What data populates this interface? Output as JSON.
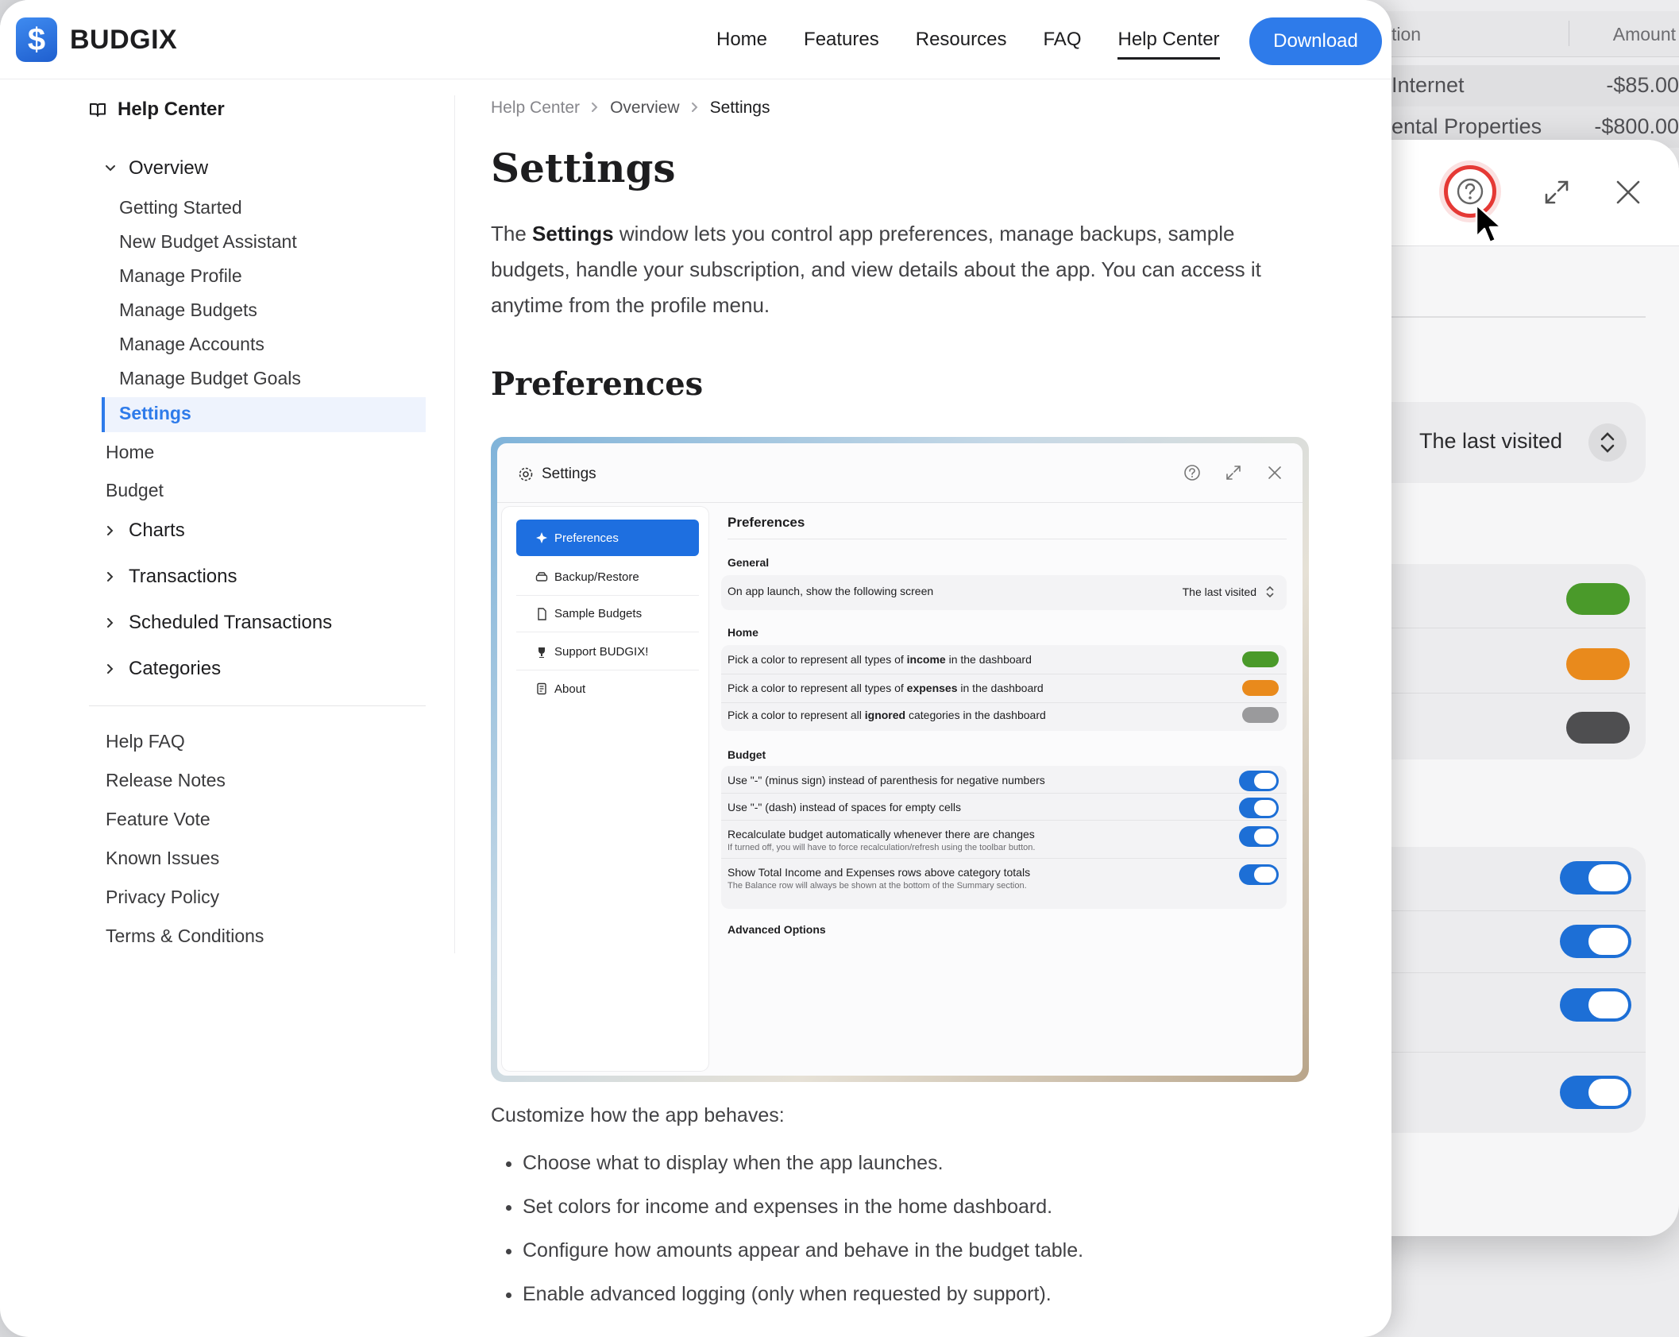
{
  "background": {
    "table": {
      "headers": [
        "tion",
        "Amount"
      ],
      "rows": [
        {
          "name": "Internet",
          "amount": "-$85.00"
        },
        {
          "name": "ental Properties",
          "amount": "-$800.00"
        }
      ]
    },
    "dialog": {
      "launch_value": "The last visited",
      "pill_colors": [
        "#4a9a2a",
        "#e98a1c",
        "#4e4e50"
      ],
      "toggles_on": [
        true,
        true,
        true,
        true
      ]
    }
  },
  "brand": {
    "name": "BUDGIX",
    "logo_glyph": "$",
    "accent": "#2e7bea"
  },
  "nav": {
    "links": [
      "Home",
      "Features",
      "Resources",
      "FAQ",
      "Help Center"
    ],
    "active": "Help Center",
    "download": "Download"
  },
  "sidebar": {
    "title": "Help Center",
    "overview": {
      "label": "Overview",
      "children": [
        "Getting Started",
        "New Budget Assistant",
        "Manage Profile",
        "Manage Budgets",
        "Manage Accounts",
        "Manage Budget Goals",
        "Settings"
      ],
      "active": "Settings"
    },
    "top_items": [
      "Home",
      "Budget"
    ],
    "groups": [
      "Charts",
      "Transactions",
      "Scheduled Transactions",
      "Categories"
    ],
    "links": [
      "Help FAQ",
      "Release Notes",
      "Feature Vote",
      "Known Issues",
      "Privacy Policy",
      "Terms & Conditions"
    ]
  },
  "content": {
    "breadcrumb": [
      "Help Center",
      "Overview",
      "Settings"
    ],
    "title": "Settings",
    "intro_pre": "The ",
    "intro_bold": "Settings",
    "intro_post": " window lets you control app preferences, manage backups, sample budgets, handle your subscription, and view details about the app. You can access it anytime from the profile menu.",
    "section_title": "Preferences",
    "paragraph": "Customize how the app behaves:",
    "bullets": [
      "Choose what to display when the app launches.",
      "Set colors for income and expenses in the home dashboard.",
      "Configure how amounts appear and behave in the budget table.",
      "Enable advanced logging (only when requested by support)."
    ]
  },
  "screenshot": {
    "window_title": "Settings",
    "nav": [
      "Preferences",
      "Backup/Restore",
      "Sample Budgets",
      "Support BUDGIX!",
      "About"
    ],
    "active_nav": "Preferences",
    "heading": "Preferences",
    "general": {
      "label": "General",
      "launch_text": "On app launch, show the following screen",
      "launch_value": "The last visited"
    },
    "home": {
      "label": "Home",
      "rows": [
        {
          "pre": "Pick a color to represent all types of ",
          "bold": "income",
          "post": " in the dashboard",
          "color": "#4a9a2a"
        },
        {
          "pre": "Pick a color to represent all types of ",
          "bold": "expenses",
          "post": " in the dashboard",
          "color": "#e98a1c"
        },
        {
          "pre": "Pick a color to represent all ",
          "bold": "ignored",
          "post": " categories in the dashboard",
          "color": "#9a9a9c"
        }
      ]
    },
    "budget": {
      "label": "Budget",
      "rows": [
        {
          "text": "Use \"-\" (minus sign) instead of parenthesis for negative numbers",
          "note": "",
          "on": true
        },
        {
          "text": "Use \"-\" (dash) instead of spaces for empty cells",
          "note": "",
          "on": true
        },
        {
          "text": "Recalculate budget automatically whenever there are changes",
          "note": "If turned off, you will have to force recalculation/refresh using the toolbar button.",
          "on": true
        },
        {
          "text": "Show Total Income and Expenses rows above category totals",
          "note": "The Balance row will always be shown at the bottom of the Summary section.",
          "on": true
        }
      ]
    },
    "advanced": "Advanced Options"
  }
}
